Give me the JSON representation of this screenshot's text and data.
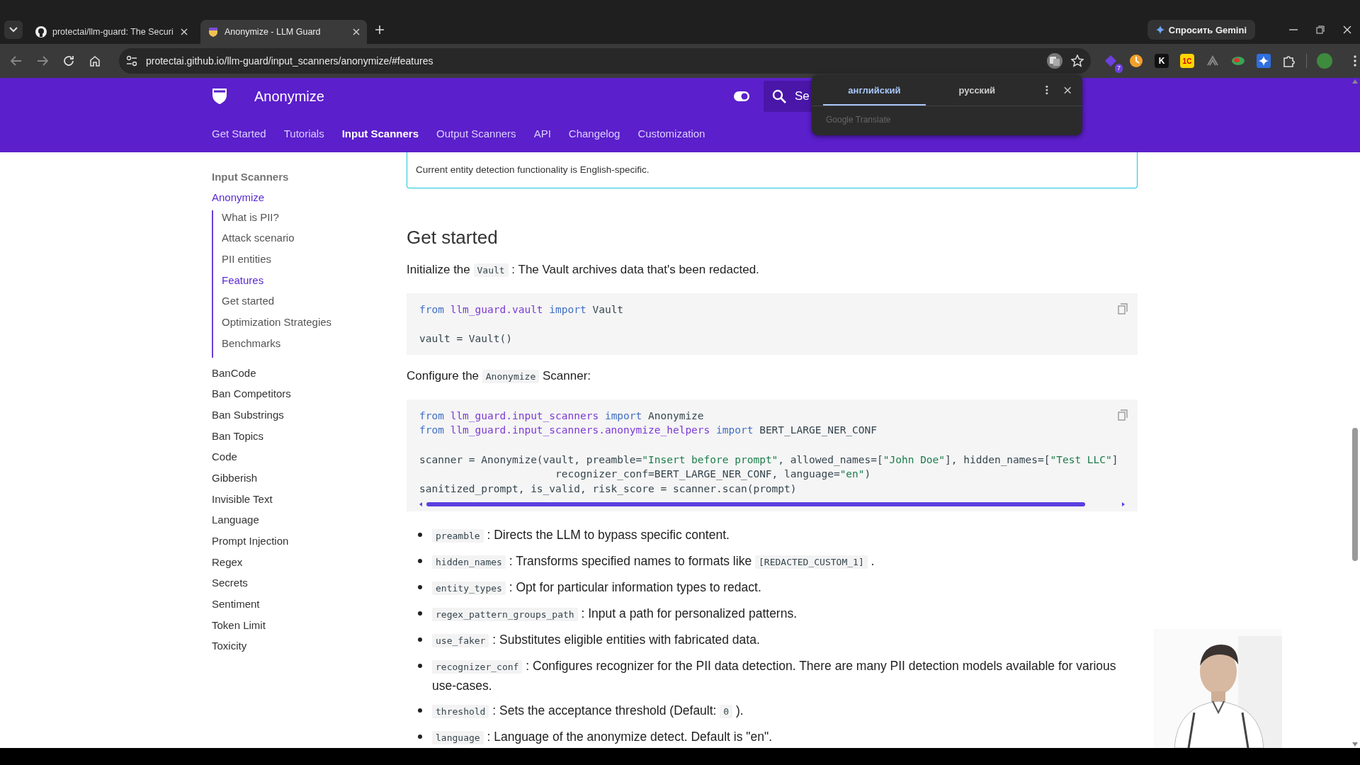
{
  "browser": {
    "tabs": [
      {
        "title": "protectai/llm-guard: The Securi",
        "kind": "github",
        "selected": false
      },
      {
        "title": "Anonymize - LLM Guard",
        "kind": "shield",
        "selected": true
      }
    ],
    "gemini_button": "Спросить Gemini",
    "address": "protectai.github.io/llm-guard/input_scanners/anonymize/#features",
    "extensions": [
      {
        "kind": "badge",
        "label": "7"
      },
      {
        "kind": "clock"
      },
      {
        "kind": "letter",
        "label": "K"
      },
      {
        "kind": "tile",
        "label": "1С"
      },
      {
        "kind": "arcs"
      },
      {
        "kind": "leaf"
      },
      {
        "kind": "sparkle"
      },
      {
        "kind": "puzzle"
      }
    ]
  },
  "site": {
    "title": "Anonymize",
    "search": {
      "placeholder": "Se"
    },
    "nav": [
      {
        "label": "Get Started",
        "selected": false
      },
      {
        "label": "Tutorials",
        "selected": false
      },
      {
        "label": "Input Scanners",
        "selected": true
      },
      {
        "label": "Output Scanners",
        "selected": false
      },
      {
        "label": "API",
        "selected": false
      },
      {
        "label": "Changelog",
        "selected": false
      },
      {
        "label": "Customization",
        "selected": false
      }
    ]
  },
  "translate_popup": {
    "languages": [
      {
        "label": "английский",
        "selected": true
      },
      {
        "label": "русский",
        "selected": false
      }
    ],
    "footer": "Google Translate"
  },
  "sidebar": {
    "heading": "Input Scanners",
    "items": [
      {
        "label": "Anonymize",
        "selected": true,
        "children": [
          {
            "label": "What is PII?",
            "selected": false
          },
          {
            "label": "Attack scenario",
            "selected": false
          },
          {
            "label": "PII entities",
            "selected": false
          },
          {
            "label": "Features",
            "selected": true
          },
          {
            "label": "Get started",
            "selected": false
          },
          {
            "label": "Optimization Strategies",
            "selected": false
          },
          {
            "label": "Benchmarks",
            "selected": false
          }
        ]
      },
      {
        "label": "BanCode",
        "selected": false
      },
      {
        "label": "Ban Competitors",
        "selected": false
      },
      {
        "label": "Ban Substrings",
        "selected": false
      },
      {
        "label": "Ban Topics",
        "selected": false
      },
      {
        "label": "Code",
        "selected": false
      },
      {
        "label": "Gibberish",
        "selected": false
      },
      {
        "label": "Invisible Text",
        "selected": false
      },
      {
        "label": "Language",
        "selected": false
      },
      {
        "label": "Prompt Injection",
        "selected": false
      },
      {
        "label": "Regex",
        "selected": false
      },
      {
        "label": "Secrets",
        "selected": false
      },
      {
        "label": "Sentiment",
        "selected": false
      },
      {
        "label": "Token Limit",
        "selected": false
      },
      {
        "label": "Toxicity",
        "selected": false
      }
    ]
  },
  "content": {
    "note": "Current entity detection functionality is English-specific.",
    "heading": "Get started",
    "blocks": [
      {
        "kind": "paragraph",
        "parts": [
          {
            "kind": "text",
            "text": "Initialize the "
          },
          {
            "kind": "code",
            "text": "Vault"
          },
          {
            "kind": "text",
            "text": " : The Vault archives data that's been redacted."
          }
        ]
      },
      {
        "kind": "code",
        "scroll": false,
        "lines": [
          {
            "gap_before": false,
            "tokens": [
              {
                "kind": "keyword",
                "s": "from"
              },
              {
                "kind": "module",
                "s": " llm_guard.vault"
              },
              {
                "kind": "keyword",
                "s": " import"
              },
              {
                "kind": "plain",
                "s": " Vault"
              }
            ]
          },
          {
            "gap_before": true,
            "tokens": [
              {
                "kind": "plain",
                "s": "vault = Vault()"
              }
            ]
          }
        ]
      },
      {
        "kind": "paragraph",
        "parts": [
          {
            "kind": "text",
            "text": "Configure the "
          },
          {
            "kind": "code",
            "text": "Anonymize"
          },
          {
            "kind": "text",
            "text": " Scanner:"
          }
        ]
      },
      {
        "kind": "code",
        "scroll": true,
        "lines": [
          {
            "gap_before": false,
            "tokens": [
              {
                "kind": "keyword",
                "s": "from"
              },
              {
                "kind": "module",
                "s": " llm_guard.input_scanners"
              },
              {
                "kind": "keyword",
                "s": " import"
              },
              {
                "kind": "plain",
                "s": " Anonymize"
              }
            ]
          },
          {
            "gap_before": false,
            "tokens": [
              {
                "kind": "keyword",
                "s": "from"
              },
              {
                "kind": "module",
                "s": " llm_guard.input_scanners.anonymize_helpers"
              },
              {
                "kind": "keyword",
                "s": " import"
              },
              {
                "kind": "plain",
                "s": " BERT_LARGE_NER_CONF"
              }
            ]
          },
          {
            "gap_before": true,
            "tokens": [
              {
                "kind": "plain",
                "s": "scanner = Anonymize(vault, preamble="
              },
              {
                "kind": "string",
                "s": "\"Insert before prompt\""
              },
              {
                "kind": "plain",
                "s": ", allowed_names=["
              },
              {
                "kind": "string",
                "s": "\"John Doe\""
              },
              {
                "kind": "plain",
                "s": "], hidden_names=["
              },
              {
                "kind": "string",
                "s": "\"Test LLC\""
              },
              {
                "kind": "plain",
                "s": "]"
              }
            ]
          },
          {
            "gap_before": false,
            "tokens": [
              {
                "kind": "plain",
                "s": "                      recognizer_conf=BERT_LARGE_NER_CONF, language="
              },
              {
                "kind": "string",
                "s": "\"en\""
              },
              {
                "kind": "plain",
                "s": ")"
              }
            ]
          },
          {
            "gap_before": false,
            "tokens": [
              {
                "kind": "plain",
                "s": "sanitized_prompt, is_valid, risk_score = scanner.scan(prompt)"
              }
            ]
          }
        ]
      }
    ],
    "bullets": [
      [
        {
          "kind": "code",
          "text": "preamble"
        },
        {
          "kind": "text",
          "text": " : Directs the LLM to bypass specific content."
        }
      ],
      [
        {
          "kind": "code",
          "text": "hidden_names"
        },
        {
          "kind": "text",
          "text": " : Transforms specified names to formats like "
        },
        {
          "kind": "code",
          "text": "[REDACTED_CUSTOM_1]"
        },
        {
          "kind": "text",
          "text": " ."
        }
      ],
      [
        {
          "kind": "code",
          "text": "entity_types"
        },
        {
          "kind": "text",
          "text": " : Opt for particular information types to redact."
        }
      ],
      [
        {
          "kind": "code",
          "text": "regex_pattern_groups_path"
        },
        {
          "kind": "text",
          "text": " : Input a path for personalized patterns."
        }
      ],
      [
        {
          "kind": "code",
          "text": "use_faker"
        },
        {
          "kind": "text",
          "text": " : Substitutes eligible entities with fabricated data."
        }
      ],
      [
        {
          "kind": "code",
          "text": "recognizer_conf"
        },
        {
          "kind": "text",
          "text": " : Configures recognizer for the PII data detection. There are many PII detection models available for various use-cases."
        }
      ],
      [
        {
          "kind": "code",
          "text": "threshold"
        },
        {
          "kind": "text",
          "text": " : Sets the acceptance threshold (Default: "
        },
        {
          "kind": "code",
          "text": "0"
        },
        {
          "kind": "text",
          "text": " )."
        }
      ],
      [
        {
          "kind": "code",
          "text": "language"
        },
        {
          "kind": "text",
          "text": " : Language of the anonymize detect. Default is \"en\"."
        }
      ]
    ]
  }
}
